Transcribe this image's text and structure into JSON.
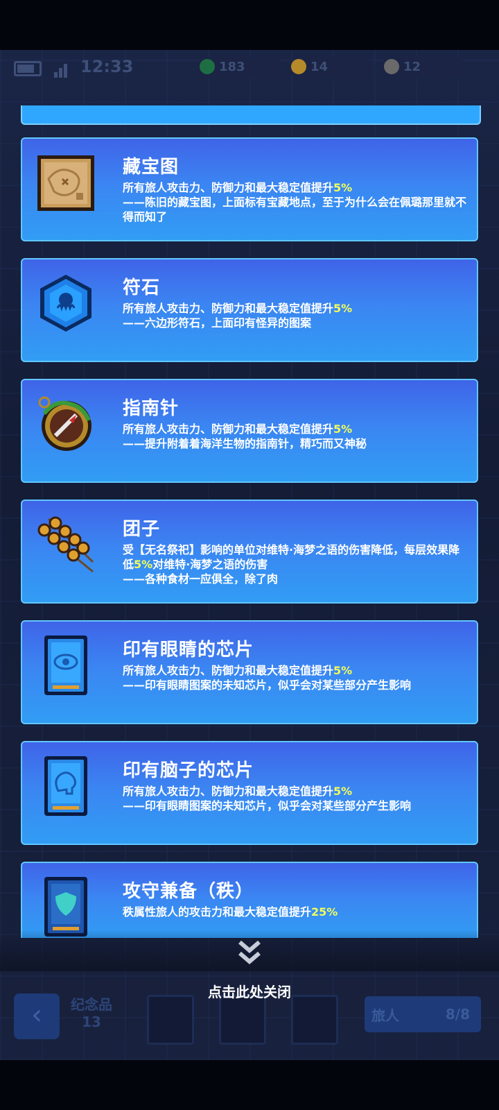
{
  "status": {
    "time": "12:33"
  },
  "currencies": [
    {
      "value": "183",
      "color": "#1e6e44"
    },
    {
      "value": "14",
      "color": "#b58a2a"
    },
    {
      "value": "12",
      "color": "#6a6a6a"
    }
  ],
  "items": [
    {
      "icon": "treasure-map-icon",
      "title": "藏宝图",
      "effect_prefix": "所有旅人攻击力、防御力和最大稳定值提升",
      "effect_value": "5%",
      "effect_suffix": "",
      "flavor": "——陈旧的藏宝图，上面标有宝藏地点，至于为什么会在佩璐那里就不得而知了"
    },
    {
      "icon": "hexagon-rune-icon",
      "title": "符石",
      "effect_prefix": "所有旅人攻击力、防御力和最大稳定值提升",
      "effect_value": "5%",
      "effect_suffix": "",
      "flavor": "——六边形符石，上面印有怪异的图案"
    },
    {
      "icon": "compass-icon",
      "title": "指南针",
      "effect_prefix": "所有旅人攻击力、防御力和最大稳定值提升",
      "effect_value": "5%",
      "effect_suffix": "",
      "flavor": "——提升附着着海洋生物的指南针，精巧而又神秘"
    },
    {
      "icon": "dango-skewer-icon",
      "title": "团子",
      "effect_prefix": "受【无名祭祀】影响的单位对维特·海梦之语的伤害降低，每层效果降低",
      "effect_value": "5%",
      "effect_suffix": "对维特·海梦之语的伤害",
      "flavor": "——各种食材一应俱全，除了肉"
    },
    {
      "icon": "eye-chip-icon",
      "title": "印有眼睛的芯片",
      "effect_prefix": "所有旅人攻击力、防御力和最大稳定值提升",
      "effect_value": "5%",
      "effect_suffix": "",
      "flavor": "——印有眼睛图案的未知芯片，似乎会对某些部分产生影响"
    },
    {
      "icon": "brain-chip-icon",
      "title": "印有脑子的芯片",
      "effect_prefix": "所有旅人攻击力、防御力和最大稳定值提升",
      "effect_value": "5%",
      "effect_suffix": "",
      "flavor": "——印有眼睛图案的未知芯片，似乎会对某些部分产生影响"
    },
    {
      "icon": "shield-chip-icon",
      "title": "攻守兼备（秩）",
      "effect_prefix": "秩属性旅人的攻击力和最大稳定值提升",
      "effect_value": "25%",
      "effect_suffix": "",
      "flavor": ""
    }
  ],
  "close_label": "点击此处关闭",
  "bottom": {
    "souvenir_label": "纪念品",
    "souvenir_count": "13",
    "traveler_label": "旅人",
    "traveler_count": "8/8"
  },
  "colors": {
    "highlight": "#f3ff5a",
    "card_border": "#63c7ff"
  }
}
